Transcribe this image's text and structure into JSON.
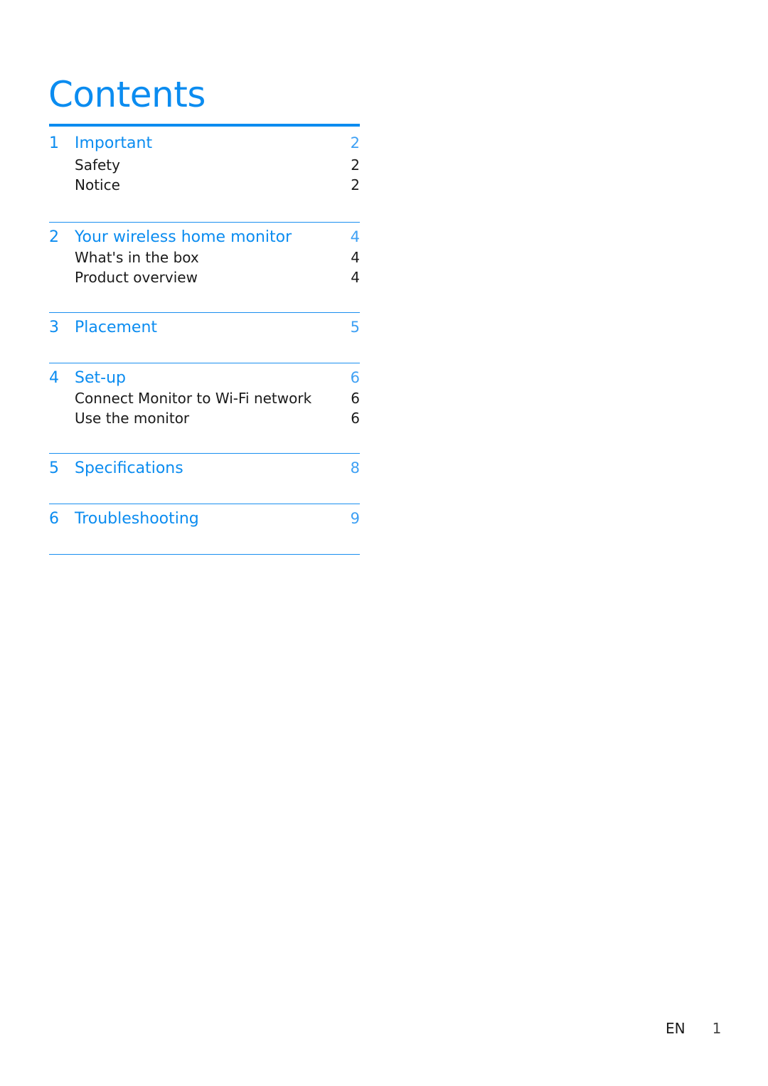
{
  "title": "Contents",
  "accent_color": "#0b8cf0",
  "sections": [
    {
      "number": "1",
      "title": "Important",
      "page": "2",
      "subsections": [
        {
          "title": "Safety",
          "page": "2"
        },
        {
          "title": "Notice",
          "page": "2"
        }
      ]
    },
    {
      "number": "2",
      "title": "Your wireless home monitor",
      "page": "4",
      "subsections": [
        {
          "title": "What's in the box",
          "page": "4"
        },
        {
          "title": "Product overview",
          "page": "4"
        }
      ]
    },
    {
      "number": "3",
      "title": "Placement",
      "page": "5",
      "subsections": []
    },
    {
      "number": "4",
      "title": "Set-up",
      "page": "6",
      "subsections": [
        {
          "title": "Connect Monitor to Wi-Fi network",
          "page": "6"
        },
        {
          "title": "Use the monitor",
          "page": "6"
        }
      ]
    },
    {
      "number": "5",
      "title": "Specifications",
      "page": "8",
      "subsections": []
    },
    {
      "number": "6",
      "title": "Troubleshooting",
      "page": "9",
      "subsections": []
    }
  ],
  "footer": {
    "language": "EN",
    "page_number": "1"
  }
}
